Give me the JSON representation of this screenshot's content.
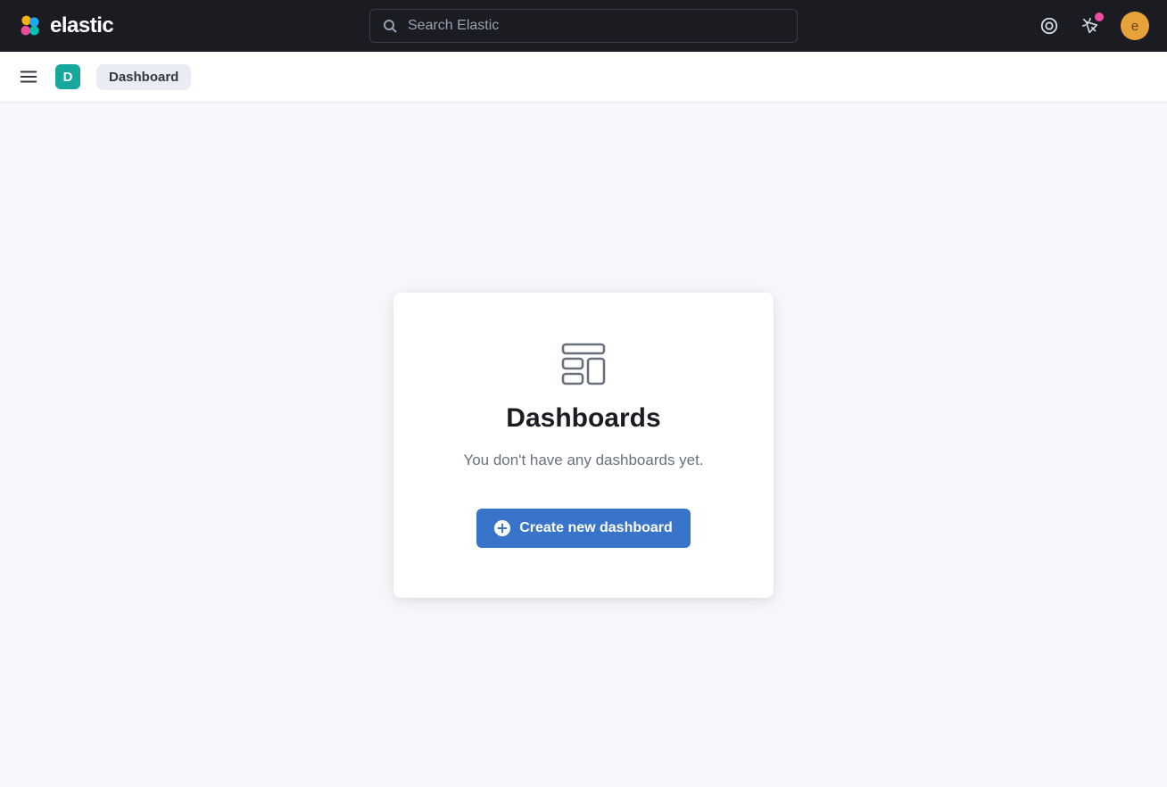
{
  "header": {
    "brand": "elastic",
    "search": {
      "placeholder": "Search Elastic"
    },
    "avatar_letter": "e"
  },
  "subheader": {
    "space_letter": "D",
    "breadcrumb": "Dashboard"
  },
  "empty_state": {
    "title": "Dashboards",
    "subtitle": "You don't have any dashboards yet.",
    "button_label": "Create new dashboard"
  },
  "colors": {
    "accent": "#3875ca",
    "space_badge": "#16a79d",
    "avatar": "#e8a23a",
    "notif": "#f04ba6"
  }
}
